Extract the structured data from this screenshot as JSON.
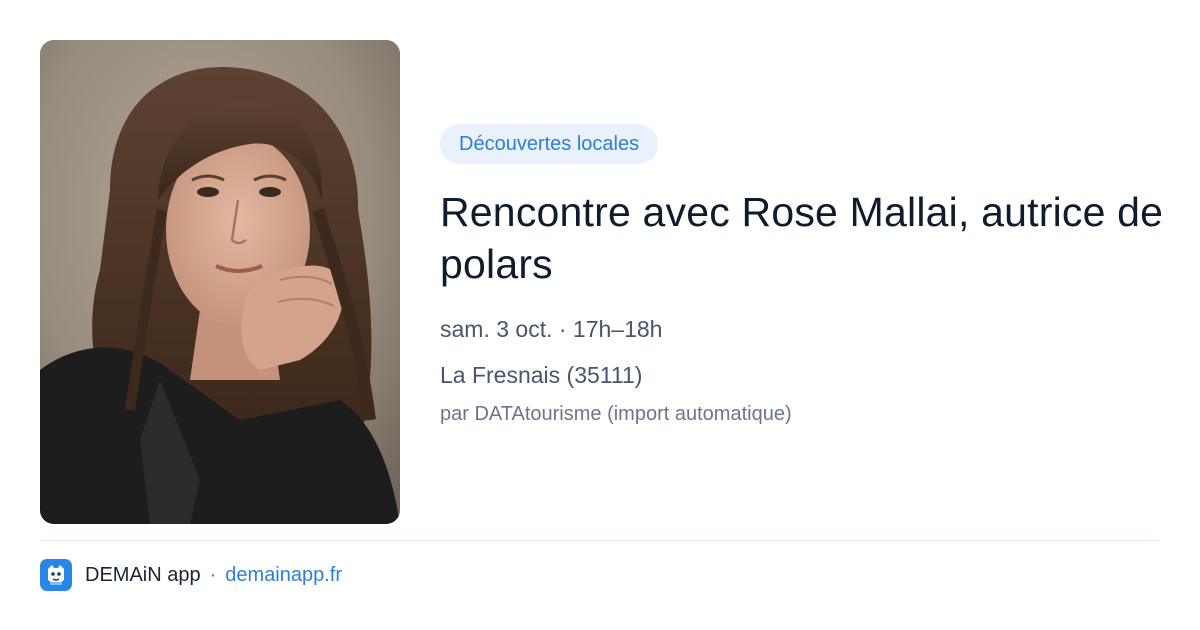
{
  "event": {
    "category": "Découvertes locales",
    "title": "Rencontre avec Rose Mallai, autrice de polars",
    "date": "sam. 3 oct. · 17h–18h",
    "location": "La Fresnais (35111)",
    "source": "par DATAtourisme (import automatique)"
  },
  "photo": {
    "subject": "portrait"
  },
  "footer": {
    "app_name": "DEMAiN app",
    "separator": "·",
    "url": "demainapp.fr",
    "icon": "demain-app-icon"
  },
  "colors": {
    "accent": "#2f7ed8",
    "badge_bg": "#e8f1fc",
    "title": "#0f1c2c",
    "meta": "#48556a",
    "muted": "#6b7789",
    "app_icon": "#2a86e6"
  }
}
